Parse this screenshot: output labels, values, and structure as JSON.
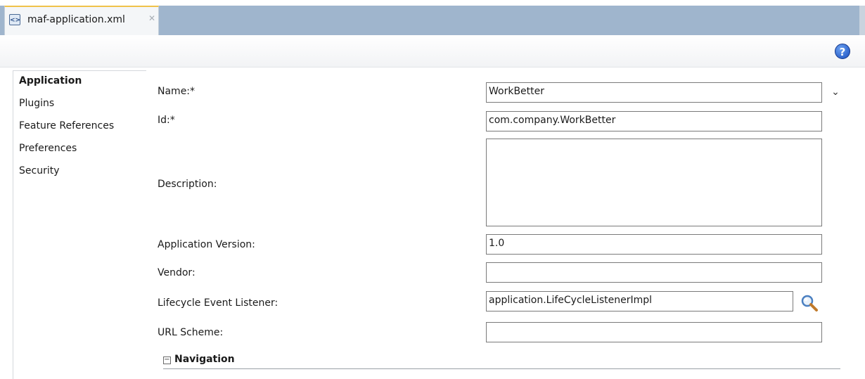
{
  "tab": {
    "label": "maf-application.xml",
    "icon": "xml-file-icon",
    "close_icon": "close-icon"
  },
  "help": {
    "icon": "help-icon",
    "glyph": "?"
  },
  "sidebar": {
    "items": [
      {
        "label": "Application",
        "active": true
      },
      {
        "label": "Plugins"
      },
      {
        "label": "Feature References"
      },
      {
        "label": "Preferences"
      },
      {
        "label": "Security"
      }
    ]
  },
  "form": {
    "name": {
      "label": "Name:*",
      "value": "WorkBetter"
    },
    "id": {
      "label": "Id:*",
      "value": "com.company.WorkBetter"
    },
    "description": {
      "label": "Description:",
      "value": ""
    },
    "app_version": {
      "label": "Application Version:",
      "value": "1.0"
    },
    "vendor": {
      "label": "Vendor:",
      "value": ""
    },
    "lifecycle": {
      "label": "Lifecycle Event Listener:",
      "value": "application.LifeCycleListenerImpl",
      "search_icon": "magnifier-icon"
    },
    "url_scheme": {
      "label": "URL Scheme:",
      "value": ""
    }
  },
  "navigation": {
    "toggle": "⊟",
    "label": "Navigation"
  },
  "colors": {
    "tabbar": "#9fb5cd",
    "active_tab_accent": "#f0c24a"
  }
}
